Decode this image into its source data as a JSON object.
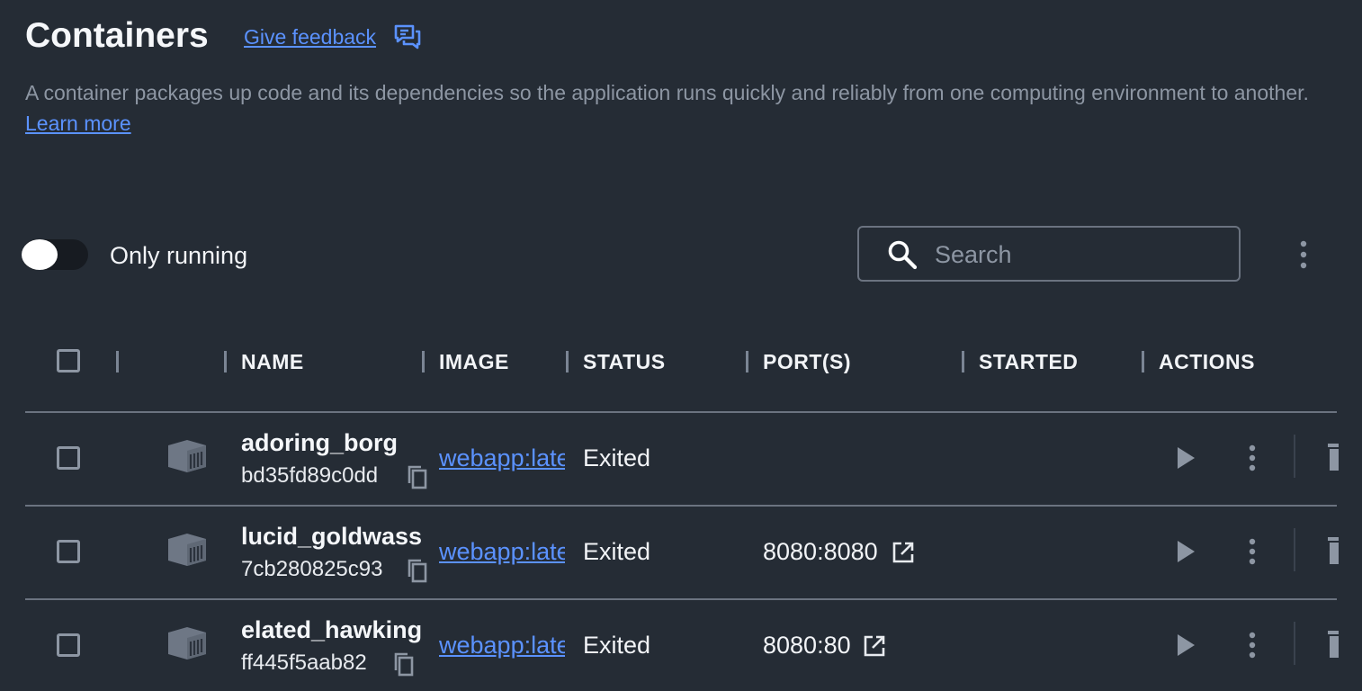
{
  "header": {
    "title": "Containers",
    "feedback_label": "Give feedback",
    "description": "A container packages up code and its dependencies so the application runs quickly and reliably from one computing environment to another.",
    "learn_more": "Learn more"
  },
  "toolbar": {
    "toggle_label": "Only running",
    "toggle_on": false,
    "search_placeholder": "Search"
  },
  "table": {
    "columns": [
      "NAME",
      "IMAGE",
      "STATUS",
      "PORT(S)",
      "STARTED",
      "ACTIONS"
    ],
    "rows": [
      {
        "name": "adoring_borg",
        "id": "bd35fd89c0dd",
        "image": "webapp:latest",
        "status": "Exited",
        "ports": "",
        "started": ""
      },
      {
        "name": "lucid_goldwasser",
        "id": "7cb280825c93",
        "image": "webapp:latest",
        "status": "Exited",
        "ports": "8080:8080",
        "started": ""
      },
      {
        "name": "elated_hawking",
        "id": "ff445f5aab82",
        "image": "webapp:latest",
        "status": "Exited",
        "ports": "8080:80",
        "started": ""
      }
    ]
  },
  "colors": {
    "background": "#252c35",
    "link": "#5b92ff",
    "muted_text": "#8d96a3",
    "border": "#6b7380",
    "icon": "#7b8594"
  },
  "icons": {
    "feedback": "chat-bubbles-icon",
    "search": "search-icon",
    "container": "container-box-icon",
    "copy": "copy-icon",
    "external_link": "external-link-icon",
    "play": "play-icon",
    "menu": "kebab-menu-icon",
    "delete": "trash-icon"
  }
}
